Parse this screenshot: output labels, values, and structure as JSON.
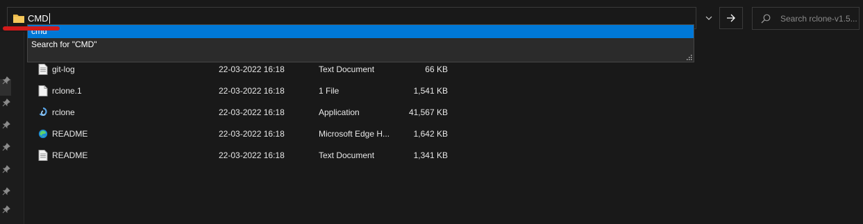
{
  "address_bar": {
    "value": "CMD",
    "search_placeholder": "Search rclone-v1.5..."
  },
  "suggestions": [
    {
      "label": "cmd"
    },
    {
      "label": "Search for \"CMD\""
    }
  ],
  "files": [
    {
      "name": "git-log",
      "date": "22-03-2022 16:18",
      "type": "Text Document",
      "size": "66 KB",
      "icon": "text-document-icon"
    },
    {
      "name": "rclone.1",
      "date": "22-03-2022 16:18",
      "type": "1 File",
      "size": "1,541 KB",
      "icon": "file-icon"
    },
    {
      "name": "rclone",
      "date": "22-03-2022 16:18",
      "type": "Application",
      "size": "41,567 KB",
      "icon": "rclone-app-icon"
    },
    {
      "name": "README",
      "date": "22-03-2022 16:18",
      "type": "Microsoft Edge H...",
      "size": "1,642 KB",
      "icon": "edge-html-icon"
    },
    {
      "name": "README",
      "date": "22-03-2022 16:18",
      "type": "Text Document",
      "size": "1,341 KB",
      "icon": "text-document-icon"
    }
  ],
  "colors": {
    "background": "#191919",
    "selection": "#0078d7",
    "annotation": "#d21a1a"
  }
}
